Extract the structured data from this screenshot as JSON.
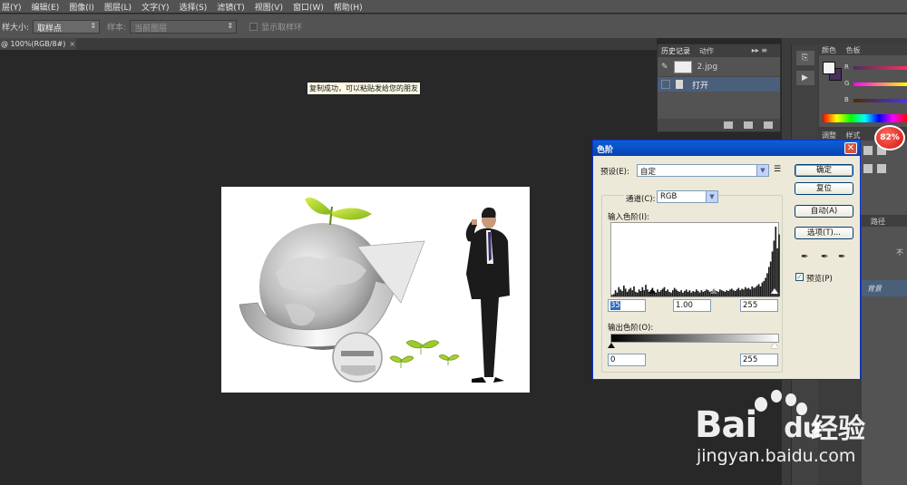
{
  "menu": {
    "items": [
      "层(Y)",
      "编辑(E)",
      "图像(I)",
      "图层(L)",
      "文字(Y)",
      "选择(S)",
      "滤镜(T)",
      "视图(V)",
      "窗口(W)",
      "帮助(H)"
    ]
  },
  "options": {
    "sample_size_label": "样大小:",
    "sample_size_value": "取样点",
    "sample_label": "样本:",
    "sample_value": "当前图层",
    "show_ring_label": "显示取样环"
  },
  "document": {
    "tab_label": "@ 100%(RGB/8#)",
    "close_glyph": "×"
  },
  "toast": "复制成功，可以粘贴发给您的朋友",
  "history_panel": {
    "tabs": [
      "历史记录",
      "动作"
    ],
    "menu_glyph": "▸▸ ≡",
    "snapshot_name": "2.jpg",
    "step": "打开"
  },
  "color_panel": {
    "tabs": [
      "颜色",
      "色板"
    ],
    "channels": [
      "R",
      "G",
      "B"
    ]
  },
  "adjust_panel": {
    "tabs": [
      "调整",
      "样式"
    ]
  },
  "layers_panel": {
    "tab": "路径",
    "partial_text": "不",
    "layer_name": "背景"
  },
  "badge": "82%",
  "levels_dialog": {
    "title": "色阶",
    "close_glyph": "✕",
    "preset_label": "预设(E):",
    "preset_value": "自定",
    "channel_label": "通道(C):",
    "channel_value": "RGB",
    "input_label": "输入色阶(I):",
    "input_black": "35",
    "input_gamma": "1.00",
    "input_white": "255",
    "output_label": "输出色阶(O):",
    "output_black": "0",
    "output_white": "255",
    "btn_ok": "确定",
    "btn_reset": "复位",
    "btn_auto": "自动(A)",
    "btn_options": "选项(T)...",
    "preview_label": "预览(P)",
    "preview_checked": true,
    "histogram": [
      2,
      3,
      8,
      5,
      12,
      9,
      7,
      14,
      10,
      6,
      9,
      11,
      8,
      13,
      6,
      5,
      9,
      7,
      12,
      8,
      15,
      9,
      6,
      8,
      11,
      7,
      5,
      9,
      6,
      8,
      10,
      12,
      7,
      9,
      6,
      5,
      8,
      11,
      9,
      7,
      6,
      8,
      5,
      7,
      9,
      6,
      8,
      5,
      7,
      6,
      9,
      7,
      5,
      8,
      6,
      7,
      9,
      8,
      6,
      7,
      5,
      8,
      7,
      6,
      9,
      8,
      7,
      6,
      8,
      7,
      9,
      10,
      8,
      7,
      9,
      11,
      8,
      10,
      9,
      12,
      10,
      11,
      9,
      13,
      11,
      12,
      14,
      16,
      13,
      18,
      20,
      24,
      30,
      38,
      45,
      58,
      72,
      90,
      62,
      80
    ]
  },
  "watermark": {
    "brand": "Bai",
    "brand_tail": "du",
    "cn": "经验",
    "url": "jingyan.baidu.com"
  }
}
